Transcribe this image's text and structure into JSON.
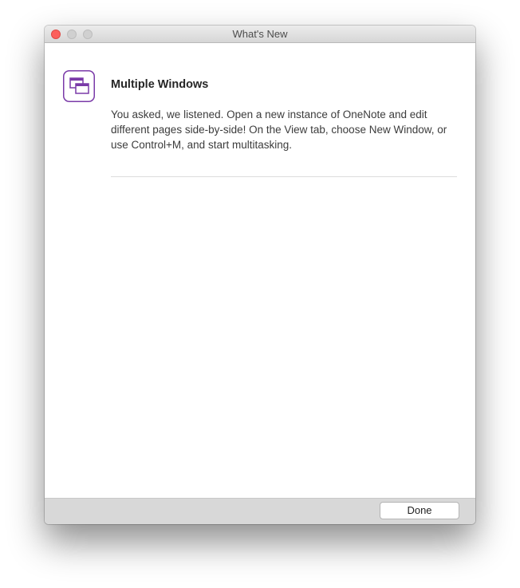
{
  "window": {
    "title": "What's New"
  },
  "feature": {
    "icon": "multiple-windows-icon",
    "title": "Multiple Windows",
    "description": "You asked, we listened. Open a new instance of OneNote and edit different pages side-by-side! On the View tab, choose New Window, or use Control+M, and start multitasking."
  },
  "footer": {
    "done_label": "Done"
  },
  "colors": {
    "accent": "#7a3aa8",
    "close_button": "#fc605c"
  }
}
